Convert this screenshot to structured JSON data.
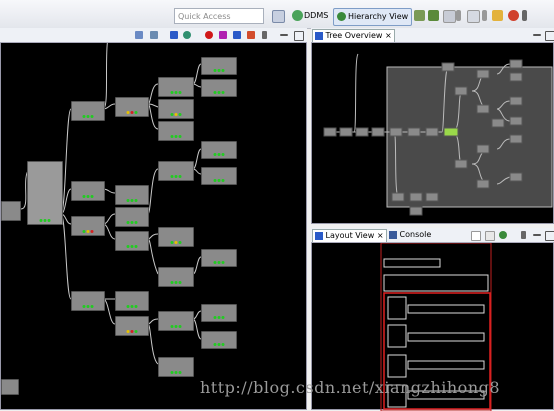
{
  "toolbar": {
    "quick_access_placeholder": "Quick Access",
    "perspectives": [
      {
        "label": "DDMS"
      },
      {
        "label": "Hierarchy View"
      }
    ]
  },
  "views": {
    "tree_overview": {
      "label": "Tree Overview"
    },
    "layout_view": {
      "label": "Layout View"
    },
    "console": {
      "label": "Console"
    }
  },
  "watermark": "http://blog.csdn.net/xiangzhihong8",
  "colors": {
    "canvas": "#000000",
    "node": "#8a8a8a",
    "status_green": "#22cc22",
    "status_yellow": "#e6c200",
    "status_red": "#d42020",
    "selected_node": "#9ad84a",
    "layout_outline": "#cc2222"
  }
}
